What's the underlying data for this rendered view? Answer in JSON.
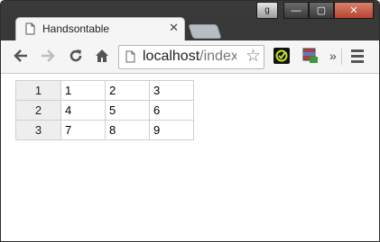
{
  "window": {
    "user_badge": "g",
    "minimize_label": "—",
    "maximize_label": "▢",
    "close_label": "✕"
  },
  "tab": {
    "title": "Handsontable",
    "close": "✕"
  },
  "toolbar": {
    "url_host": "localhost",
    "url_rest": "/index",
    "overflow_label": "»",
    "star_label": "☆"
  },
  "table": {
    "row_headers": [
      "1",
      "2",
      "3"
    ],
    "rows": [
      [
        "1",
        "2",
        "3"
      ],
      [
        "4",
        "5",
        "6"
      ],
      [
        "7",
        "8",
        "9"
      ]
    ]
  }
}
